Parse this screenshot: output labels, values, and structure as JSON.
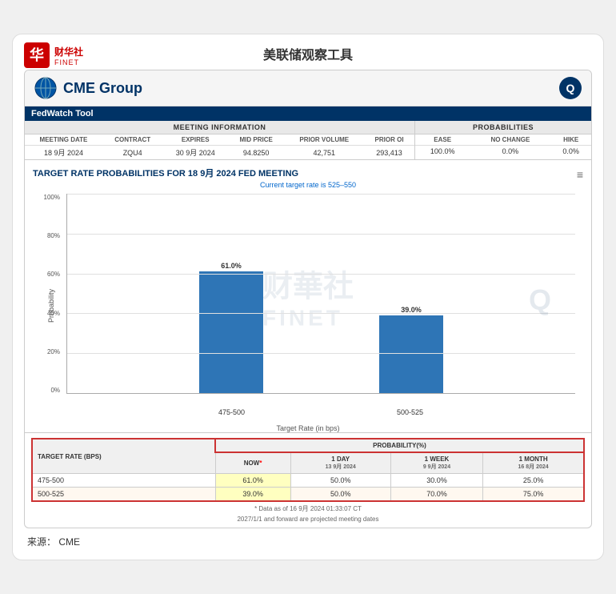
{
  "page": {
    "title": "美联储观察工具",
    "source": "来源：  CME"
  },
  "logo": {
    "cn": "财华社",
    "en": "FINET"
  },
  "cme": {
    "name": "CME Group",
    "tool": "FedWatch Tool"
  },
  "meeting_info": {
    "header": "MEETING INFORMATION",
    "columns": [
      "MEETING DATE",
      "CONTRACT",
      "EXPIRES",
      "MID PRICE",
      "PRIOR VOLUME",
      "PRIOR OI"
    ],
    "row": {
      "meeting_date": "18 9月 2024",
      "contract": "ZQU4",
      "expires": "30 9月 2024",
      "mid_price": "94.8250",
      "prior_volume": "42,751",
      "prior_oi": "293,413"
    }
  },
  "probabilities": {
    "header": "PROBABILITIES",
    "columns": [
      "EASE",
      "NO CHANGE",
      "HIKE"
    ],
    "row": {
      "ease": "100.0%",
      "no_change": "0.0%",
      "hike": "0.0%"
    }
  },
  "chart": {
    "title": "TARGET RATE PROBABILITIES FOR 18 9月 2024 FED MEETING",
    "subtitle": "Current target rate is 525–550",
    "y_labels": [
      "100%",
      "80%",
      "60%",
      "40%",
      "20%",
      "0%"
    ],
    "y_axis_title": "Probability",
    "x_axis_title": "Target Rate (in bps)",
    "bars": [
      {
        "label": "475-500",
        "value": 61.0,
        "height_pct": 61
      },
      {
        "label": "500-525",
        "value": 39.0,
        "height_pct": 39
      }
    ]
  },
  "prob_table": {
    "header_main": "PROBABILITY(%)",
    "col_target": "TARGET RATE (BPS)",
    "col_now": "NOW",
    "col_now_note": "*",
    "col_1day": "1 DAY",
    "col_1day_date": "13 9月 2024",
    "col_1week": "1 WEEK",
    "col_1week_date": "9 9月 2024",
    "col_1month": "1 MONTH",
    "col_1month_date": "16 8月 2024",
    "rows": [
      {
        "rate": "475-500",
        "now": "61.0%",
        "day1": "50.0%",
        "week1": "30.0%",
        "month1": "25.0%"
      },
      {
        "rate": "500-525",
        "now": "39.0%",
        "day1": "50.0%",
        "week1": "70.0%",
        "month1": "75.0%"
      }
    ],
    "footnote": "* Data as of 16 9月 2024 01:33:07 CT",
    "footer": "2027/1/1 and forward are projected meeting dates"
  }
}
